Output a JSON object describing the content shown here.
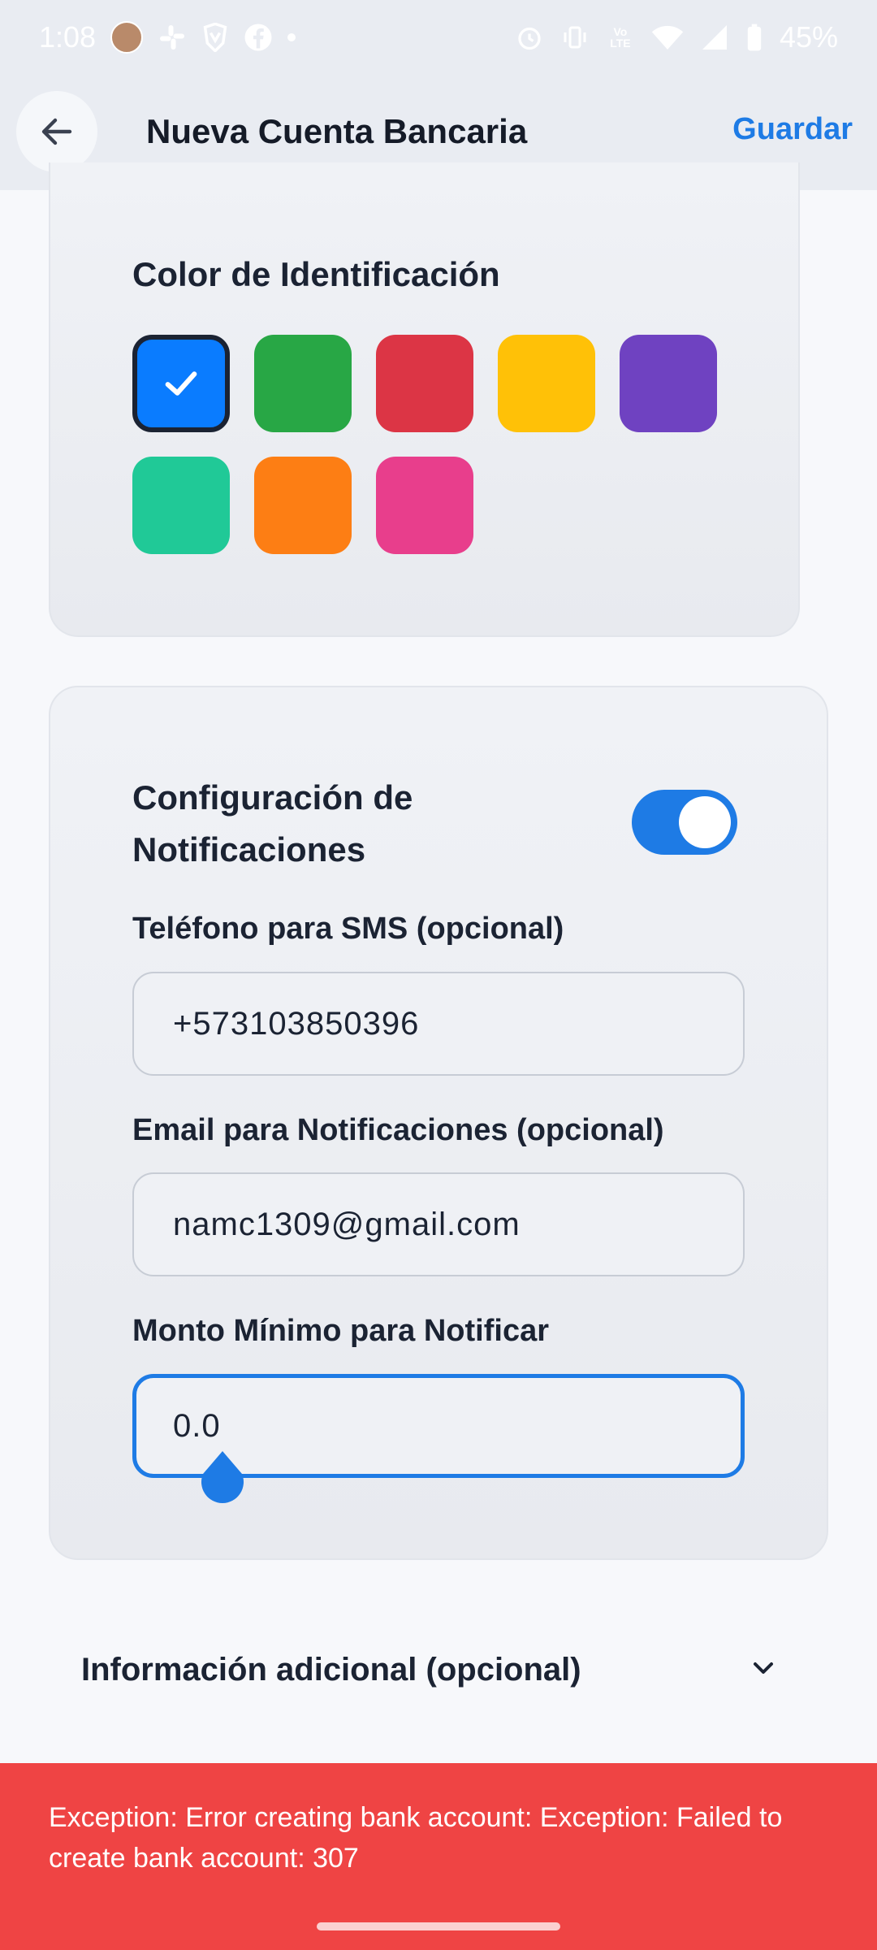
{
  "status_bar": {
    "time": "1:08",
    "battery": "45%",
    "network_label": "Vo LTE"
  },
  "app_bar": {
    "title": "Nueva Cuenta Bancaria",
    "save_label": "Guardar",
    "back_icon": "arrow-left-icon"
  },
  "color_section": {
    "title": "Color de Identificación",
    "swatches": [
      {
        "color": "#0a7cff",
        "selected": true
      },
      {
        "color": "#28a745"
      },
      {
        "color": "#dc3545"
      },
      {
        "color": "#ffc107"
      },
      {
        "color": "#6f42c1"
      },
      {
        "color": "#20c997"
      },
      {
        "color": "#fd7e14"
      },
      {
        "color": "#e83e8c"
      }
    ]
  },
  "notifications": {
    "title_line1": "Configuración de",
    "title_line2": "Notificaciones",
    "enabled": true,
    "sms_label": "Teléfono para SMS (opcional)",
    "sms_value": "+573103850396",
    "email_label": "Email para Notificaciones (opcional)",
    "email_value": "namc1309@gmail.com",
    "min_amount_label": "Monto Mínimo para Notificar",
    "min_amount_value": "0.0"
  },
  "additional_info": {
    "label": "Información adicional (opcional)",
    "chevron_icon": "chevron-down-icon"
  },
  "snackbar": {
    "message": "Exception: Error creating bank account: Exception: Failed to create bank account: 307"
  },
  "colors": {
    "accent": "#1e7be5",
    "error": "#ef4444"
  }
}
